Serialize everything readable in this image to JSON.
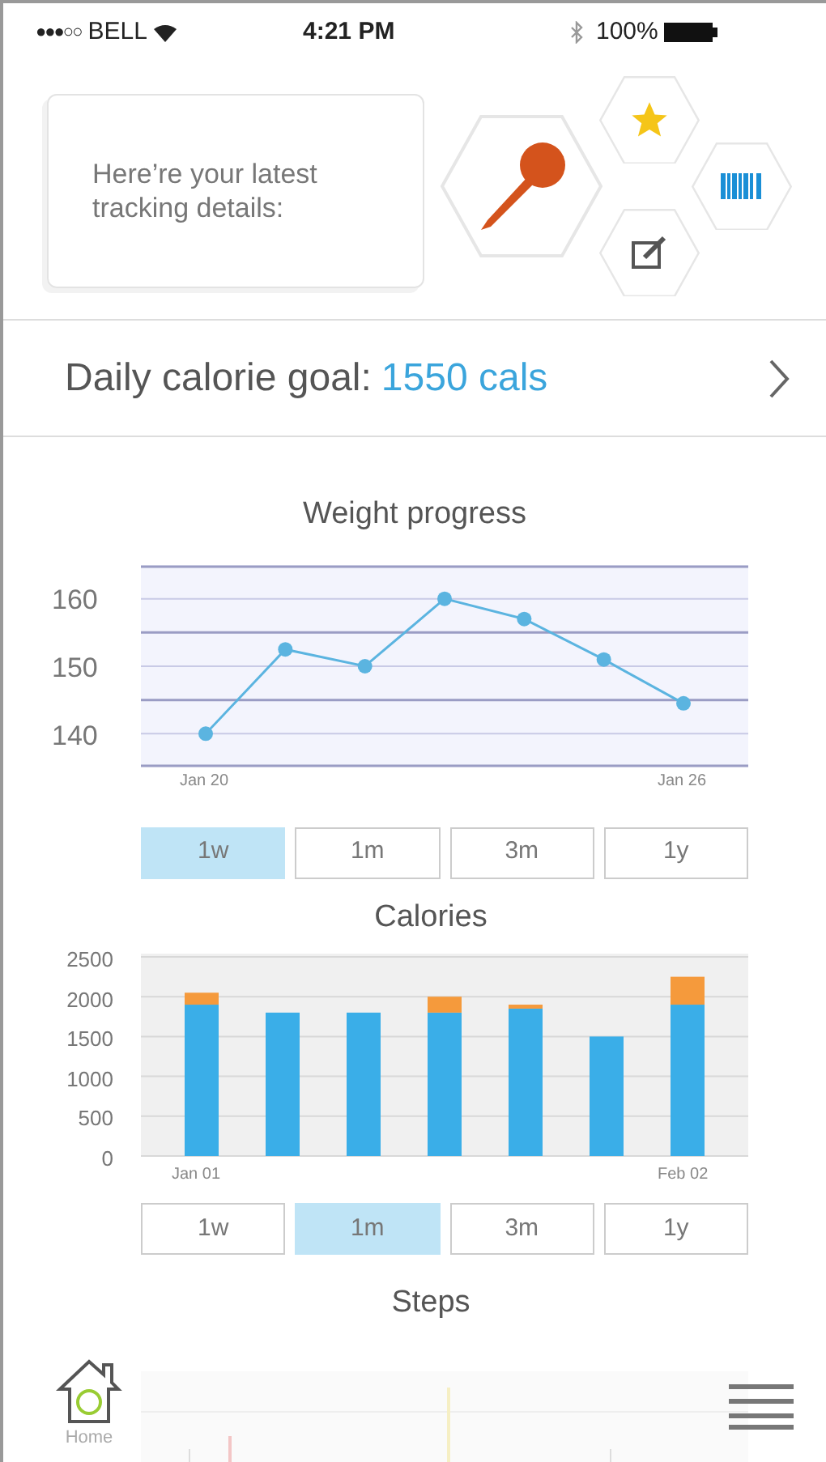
{
  "status_bar": {
    "signal": "●●●○○",
    "carrier": "BELL",
    "time": "4:21 PM",
    "battery": "100%"
  },
  "header": {
    "message": "Here’re your latest tracking details:"
  },
  "calorie_goal": {
    "label": "Daily calorie goal:",
    "value": "1550 cals"
  },
  "weight": {
    "title": "Weight progress",
    "chart_data": {
      "type": "line",
      "grid": true,
      "categories": [
        "Jan 20",
        null,
        null,
        null,
        null,
        null,
        "Jan 26"
      ],
      "yticks": [
        140,
        150,
        160
      ],
      "ylim": [
        135,
        165
      ],
      "ref_lines": [
        {
          "axis": "y",
          "value": 155
        },
        {
          "axis": "y",
          "value": 145
        }
      ],
      "series": [
        {
          "color": "#5bb4e0",
          "marker": "circle",
          "values": [
            140,
            152.5,
            150,
            160,
            157,
            151,
            144.5
          ]
        }
      ]
    },
    "ranges": [
      {
        "label": "1w",
        "selected": true
      },
      {
        "label": "1m",
        "selected": false
      },
      {
        "label": "3m",
        "selected": false
      },
      {
        "label": "1y",
        "selected": false
      }
    ]
  },
  "calories": {
    "title": "Calories",
    "chart_data": {
      "type": "bar",
      "stacked": true,
      "grid": true,
      "categories": [
        "Jan 01",
        null,
        null,
        null,
        null,
        null,
        "Feb 02"
      ],
      "yticks": [
        0,
        500,
        1000,
        1500,
        2000,
        2500
      ],
      "ylim": [
        0,
        2500
      ],
      "series": [
        {
          "color": "#3aaee8",
          "values": [
            1900,
            1800,
            1800,
            1800,
            1850,
            1500,
            1900
          ]
        },
        {
          "color": "#f59a3c",
          "values": [
            150,
            0,
            0,
            200,
            50,
            0,
            350
          ]
        }
      ]
    },
    "ranges": [
      {
        "label": "1w",
        "selected": false
      },
      {
        "label": "1m",
        "selected": true
      },
      {
        "label": "3m",
        "selected": false
      },
      {
        "label": "1y",
        "selected": false
      }
    ]
  },
  "steps": {
    "title": "Steps"
  },
  "bottom_bar": {
    "home_label": "Home"
  }
}
